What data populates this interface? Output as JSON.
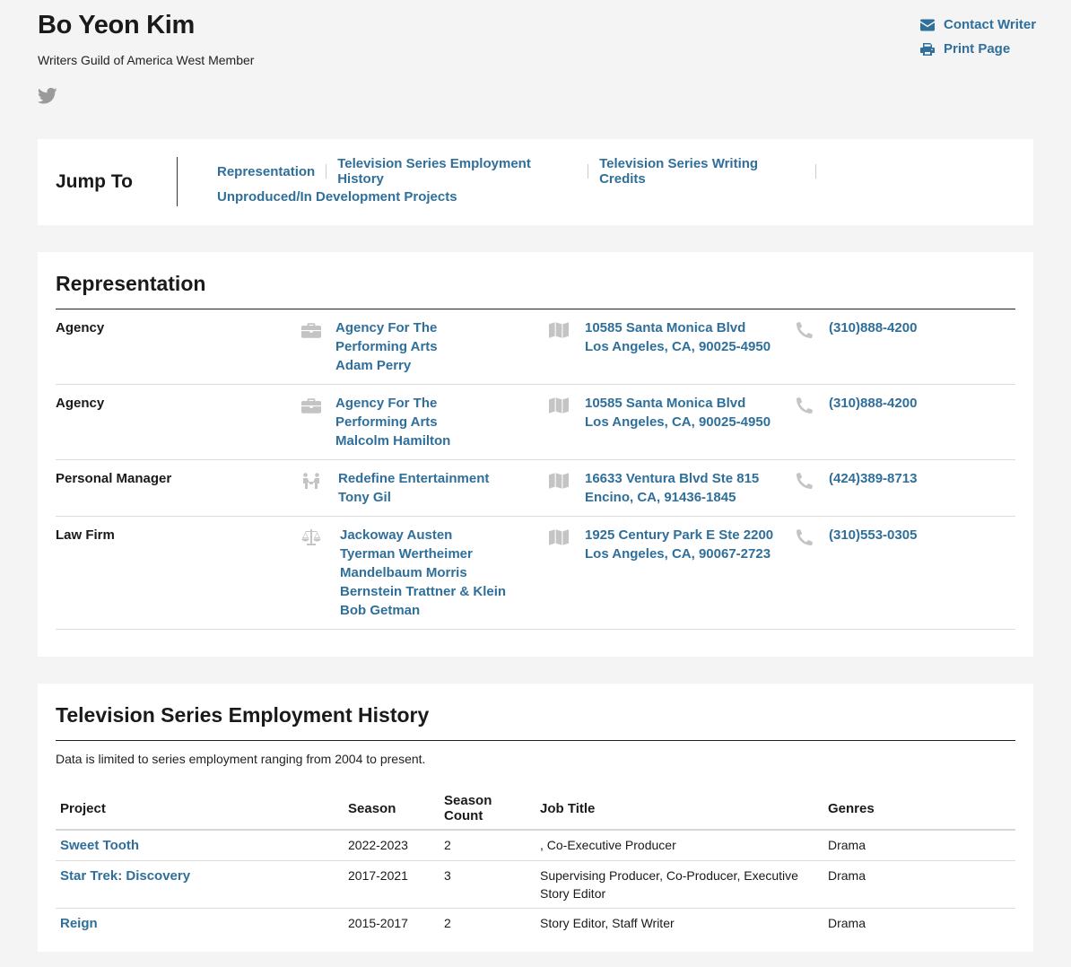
{
  "header": {
    "name": "Bo Yeon Kim",
    "membership": "Writers Guild of America West Member",
    "social_icon": "twitter-icon",
    "actions": {
      "contact_label": "Contact Writer",
      "print_label": "Print Page"
    }
  },
  "jump_to": {
    "title": "Jump To",
    "links": [
      "Representation",
      "Television Series Employment History",
      "Television Series Writing Credits",
      "Unproduced/In Development Projects"
    ]
  },
  "representation": {
    "title": "Representation",
    "rows": [
      {
        "type": "Agency",
        "icon": "briefcase-icon",
        "company": "Agency For The Performing Arts",
        "contact": "Adam Perry",
        "address_line1": "10585 Santa Monica Blvd",
        "address_line2": "Los Angeles, CA, 90025-4950",
        "phone": "(310)888-4200"
      },
      {
        "type": "Agency",
        "icon": "briefcase-icon",
        "company": "Agency For The Performing Arts",
        "contact": "Malcolm Hamilton",
        "address_line1": "10585 Santa Monica Blvd",
        "address_line2": "Los Angeles, CA, 90025-4950",
        "phone": "(310)888-4200"
      },
      {
        "type": "Personal Manager",
        "icon": "people-icon",
        "company": "Redefine Entertainment",
        "contact": "Tony Gil",
        "address_line1": "16633 Ventura Blvd Ste 815",
        "address_line2": "Encino, CA, 91436-1845",
        "phone": "(424)389-8713"
      },
      {
        "type": "Law Firm",
        "icon": "scales-icon",
        "company": "Jackoway Austen Tyerman Wertheimer Mandelbaum Morris Bernstein Trattner & Klein",
        "contact": "Bob Getman",
        "address_line1": "1925 Century Park E Ste 2200",
        "address_line2": "Los Angeles, CA, 90067-2723",
        "phone": "(310)553-0305"
      }
    ]
  },
  "employment": {
    "title": "Television Series Employment History",
    "note": "Data is limited to series employment ranging from 2004 to present.",
    "columns": [
      "Project",
      "Season",
      "Season Count",
      "Job Title",
      "Genres"
    ],
    "rows": [
      {
        "project": "Sweet Tooth",
        "season": "2022-2023",
        "count": "2",
        "job": ", Co-Executive Producer",
        "genre": "Drama"
      },
      {
        "project": "Star Trek: Discovery",
        "season": "2017-2021",
        "count": "3",
        "job": "Supervising Producer, Co-Producer, Executive Story Editor",
        "genre": "Drama"
      },
      {
        "project": "Reign",
        "season": "2015-2017",
        "count": "2",
        "job": "Story Editor, Staff Writer",
        "genre": "Drama"
      }
    ]
  }
}
